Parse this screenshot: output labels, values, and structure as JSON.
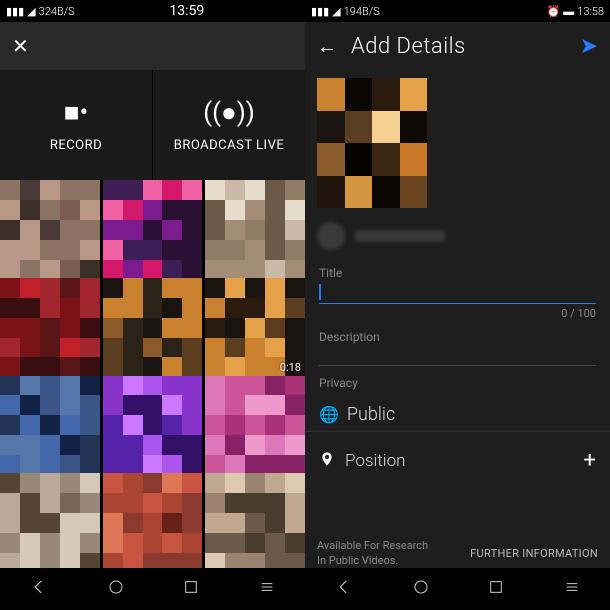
{
  "left": {
    "status": {
      "signal": "324B/S",
      "time": "13:59"
    },
    "actions": {
      "record": "RECORD",
      "broadcast": "BROADCAST LIVE"
    },
    "duration_cell": "0:18"
  },
  "right": {
    "status": {
      "signal": "194B/S",
      "time": "13:58"
    },
    "title": "Add Details",
    "title_field": {
      "label": "Title",
      "counter": "0 / 100"
    },
    "desc_field": {
      "label": "Description"
    },
    "privacy": {
      "label": "Privacy",
      "value": "Public"
    },
    "position": {
      "label": "Position"
    },
    "footer": {
      "left_line1": "Available For Research",
      "left_line2": "In Public Videos.",
      "right": "FURTHER INFORMATION"
    }
  },
  "pixelated_palettes": [
    [
      "#4a3b38",
      "#7a5c52",
      "#b89786",
      "#3b3028",
      "#8a7363"
    ],
    [
      "#d4186a",
      "#7c1b8f",
      "#2a1033",
      "#f062a3",
      "#3d1f55"
    ],
    [
      "#c9b9a6",
      "#a38d76",
      "#6b5a48",
      "#e6dccb",
      "#8f7c66"
    ],
    [
      "#7a1218",
      "#c11f2a",
      "#3a0d0e",
      "#a3262f",
      "#5a1519"
    ],
    [
      "#1a1410",
      "#c9802f",
      "#5a3d1f",
      "#2b2218",
      "#8a5a28"
    ],
    [
      "#c9802f",
      "#1a1410",
      "#5a3d1f",
      "#e5a04a",
      "#2b1b0e"
    ],
    [
      "#223355",
      "#3a5588",
      "#5577aa",
      "#112244",
      "#4466aa"
    ],
    [
      "#8833cc",
      "#aa55ee",
      "#5522aa",
      "#cc77ff",
      "#331166"
    ],
    [
      "#cc5599",
      "#dd77bb",
      "#aa3377",
      "#ee99cc",
      "#882266"
    ],
    [
      "#d4c9b8",
      "#998877",
      "#776655",
      "#bbaa99",
      "#554433"
    ],
    [
      "#8a3a2f",
      "#c95540",
      "#aa4433",
      "#662218",
      "#dd7755"
    ],
    [
      "#c0a890",
      "#9a8470",
      "#6b5a4a",
      "#ddc9b0",
      "#4a3d30"
    ]
  ],
  "thumb_palette": [
    "#c9802f",
    "#0a0805",
    "#2b1b0e",
    "#e5a04a",
    "#1a1410",
    "#5a3d1f",
    "#f5d090",
    "#0f0a06",
    "#8a5a28",
    "#050302",
    "#3a2815",
    "#c97828",
    "#1f140a",
    "#d49540",
    "#0a0704",
    "#6a4520"
  ]
}
